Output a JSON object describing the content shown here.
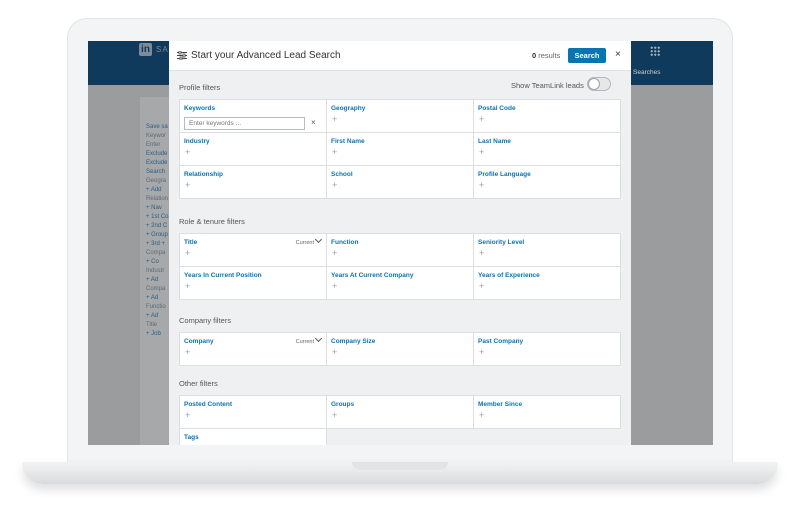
{
  "app": {
    "brand": "SA",
    "logo": "in",
    "searches": "Searches",
    "lines": [
      "Save sa",
      "Keywor",
      "Enter",
      "Exclude",
      "Exclude",
      "Search",
      "Geogra",
      "+ Add",
      "Relation",
      "+ Nav",
      "+ 1st Co",
      "+ 2nd C",
      "+ Group",
      "+ 3rd +",
      "Compa",
      "+ Co",
      "Industr",
      "+ Ad",
      "Compa",
      "+ Ad",
      "Functio",
      "+ Ad",
      "Title",
      "+ Job"
    ]
  },
  "modal": {
    "title": "Start your Advanced Lead Search",
    "results_count": "0",
    "results_label": "results",
    "search_button": "Search",
    "close": "×",
    "toggle_label": "Show TeamLink leads",
    "toggle_on": false
  },
  "profile": {
    "title": "Profile filters",
    "keywords_label": "Keywords",
    "keywords_placeholder": "Enter keywords ...",
    "keywords_clear": "×",
    "geography": "Geography",
    "postal_code": "Postal Code",
    "industry": "Industry",
    "first_name": "First Name",
    "last_name": "Last Name",
    "relationship": "Relationship",
    "school": "School",
    "profile_language": "Profile Language"
  },
  "role": {
    "title": "Role & tenure filters",
    "title_filter": "Title",
    "title_current": "Current",
    "function": "Function",
    "seniority": "Seniority Level",
    "years_position": "Years In Current Position",
    "years_company": "Years At Current Company",
    "years_experience": "Years of Experience"
  },
  "company": {
    "title": "Company filters",
    "company": "Company",
    "company_current": "Current",
    "size": "Company Size",
    "past": "Past Company"
  },
  "other": {
    "title": "Other filters",
    "posted": "Posted Content",
    "groups": "Groups",
    "member_since": "Member Since",
    "tags": "Tags"
  },
  "plus": "+",
  "colors": {
    "accent": "#0a73b1",
    "nav": "#103a5b"
  }
}
